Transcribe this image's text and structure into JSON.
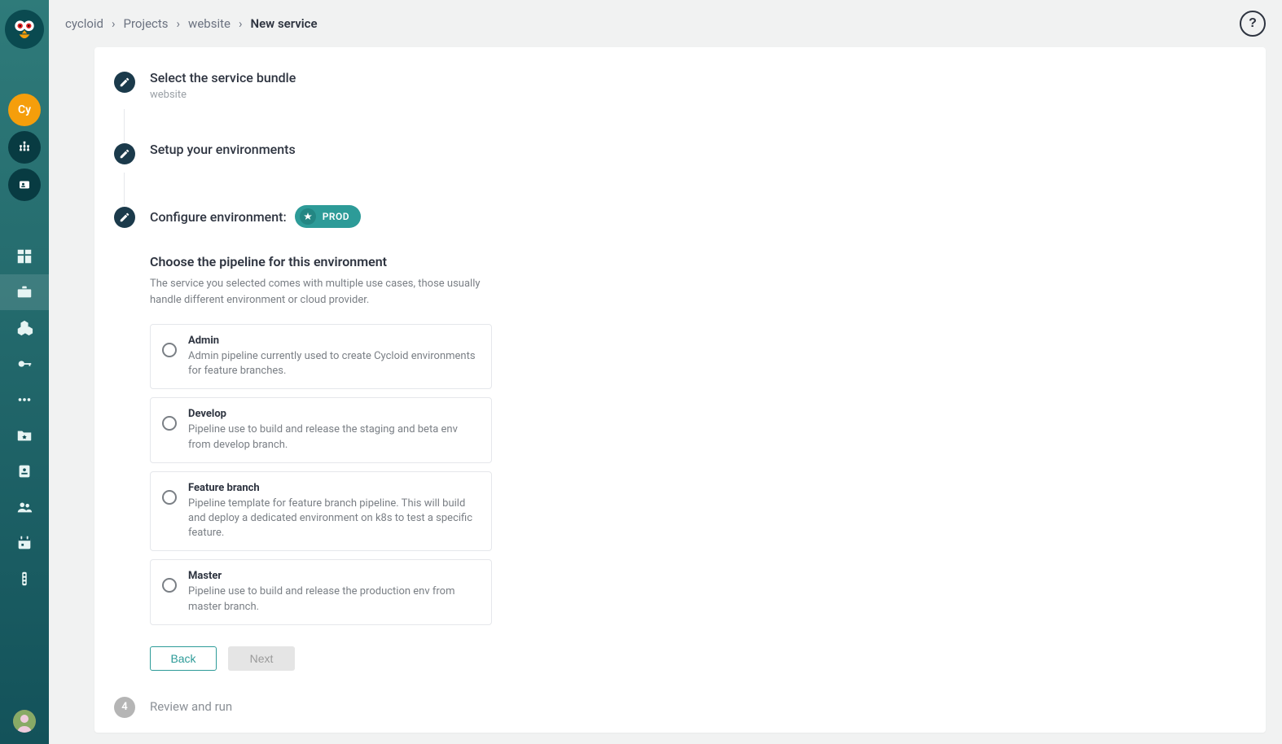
{
  "breadcrumbs": {
    "org": "cycloid",
    "projects": "Projects",
    "project": "website",
    "current": "New service"
  },
  "help_label": "?",
  "sidebar": {
    "org_badge": "Cy"
  },
  "steps": {
    "s1": {
      "title": "Select the service bundle",
      "sub": "website"
    },
    "s2": {
      "title": "Setup your environments"
    },
    "s3": {
      "title_prefix": "Configure environment:",
      "env_label": "PROD"
    },
    "s4": {
      "num": "4",
      "title": "Review and run"
    }
  },
  "content": {
    "title": "Choose the pipeline for this environment",
    "desc": "The service you selected comes with multiple use cases, those usually handle different environment or cloud provider.",
    "options": [
      {
        "title": "Admin",
        "desc": "Admin pipeline currently used to create Cycloid environments for feature branches."
      },
      {
        "title": "Develop",
        "desc": "Pipeline use to build and release the staging and beta env from develop branch."
      },
      {
        "title": "Feature branch",
        "desc": "Pipeline template for feature branch pipeline. This will build and deploy a dedicated environment on k8s to test a specific feature."
      },
      {
        "title": "Master",
        "desc": "Pipeline use to build and release the production env from master branch."
      }
    ],
    "back_label": "Back",
    "next_label": "Next"
  }
}
